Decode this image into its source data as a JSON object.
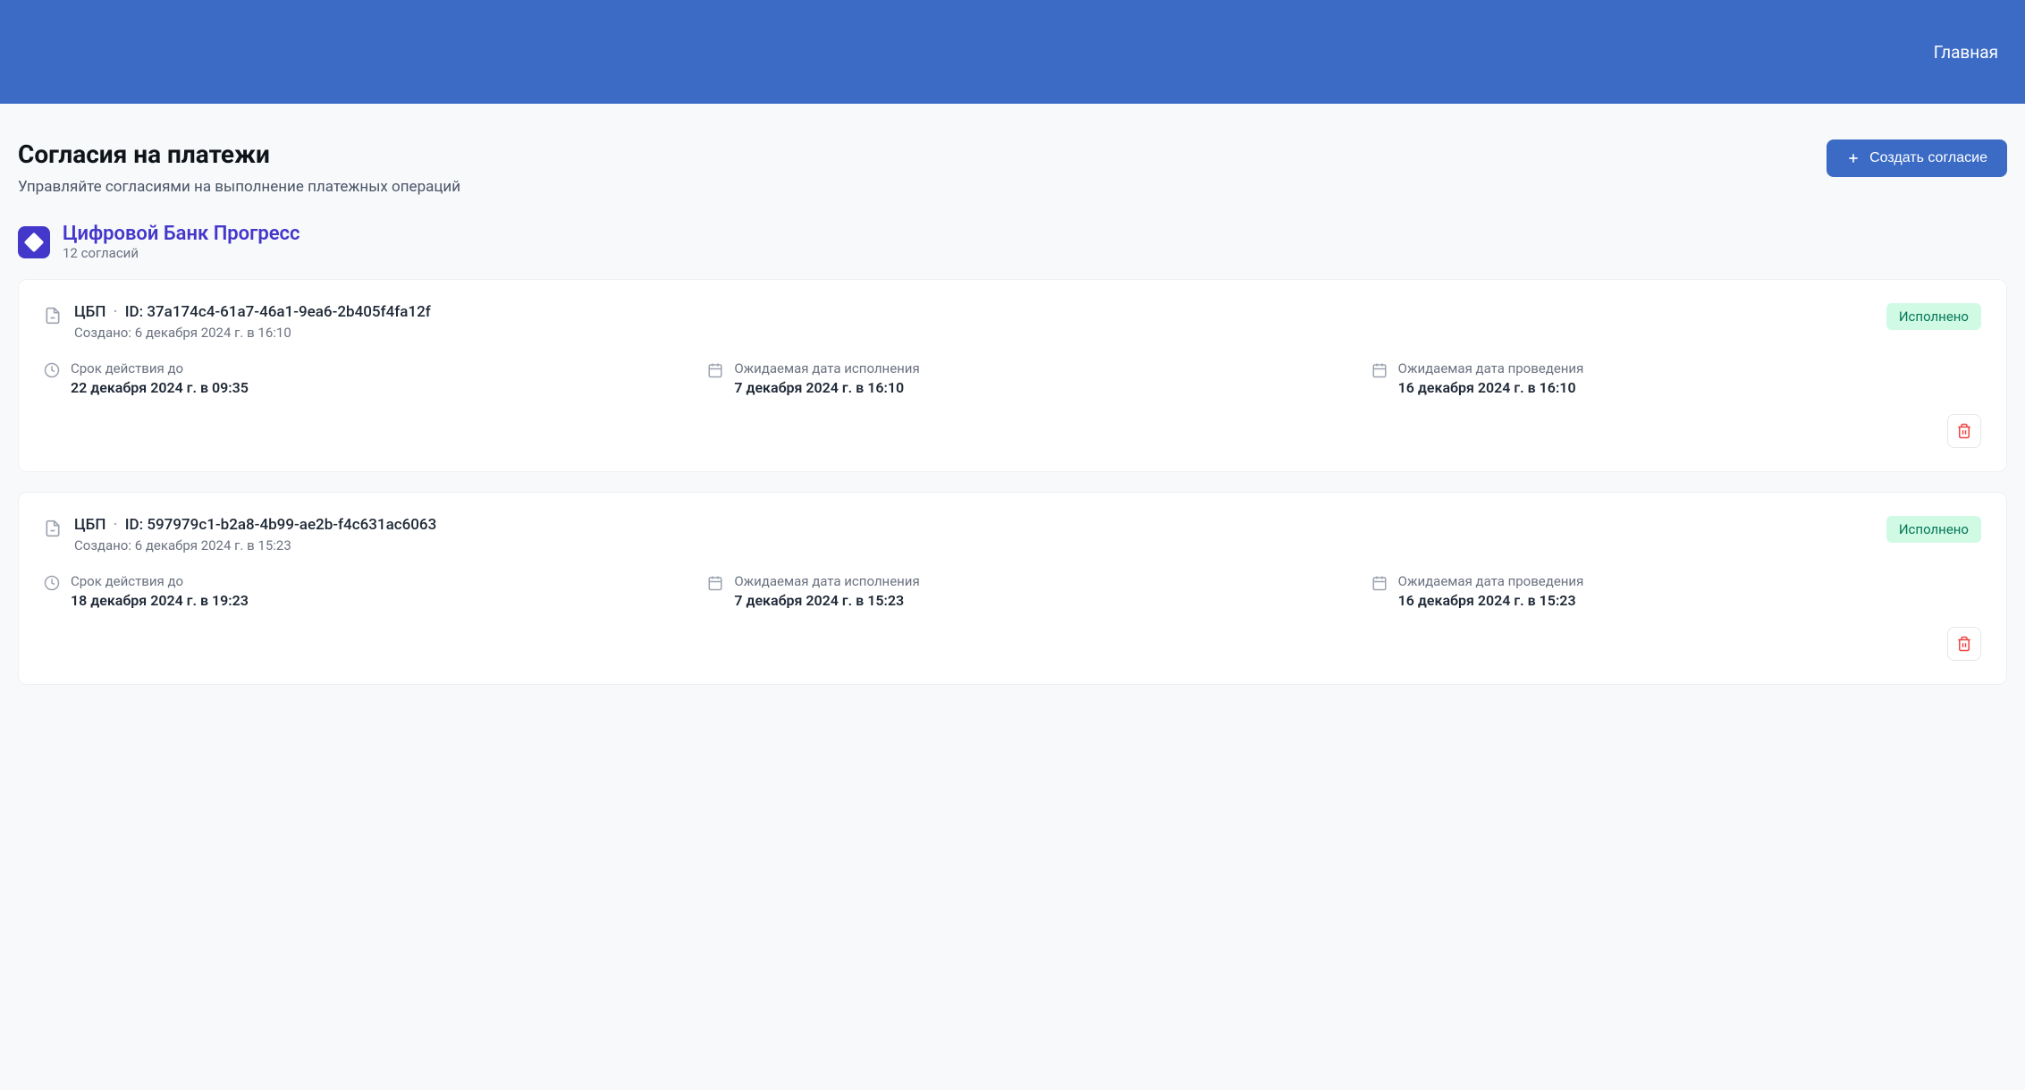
{
  "header": {
    "home_link": "Главная"
  },
  "page": {
    "title": "Согласия на платежи",
    "subtitle": "Управляйте согласиями на выполнение платежных операций",
    "create_button": "Создать согласие"
  },
  "bank": {
    "name": "Цифровой Банк Прогресс",
    "count": "12 согласий"
  },
  "labels": {
    "created_prefix": "Создано: ",
    "validity": "Срок действия до",
    "expected_execution": "Ожидаемая дата исполнения",
    "expected_settlement": "Ожидаемая дата проведения"
  },
  "consents": [
    {
      "code": "ЦБП",
      "id_label": "ID: 37a174c4-61a7-46a1-9ea6-2b405f4fa12f",
      "created": "6 декабря 2024 г. в 16:10",
      "status": "Исполнено",
      "validity_date": "22 декабря 2024 г. в 09:35",
      "execution_date": "7 декабря 2024 г. в 16:10",
      "settlement_date": "16 декабря 2024 г. в 16:10"
    },
    {
      "code": "ЦБП",
      "id_label": "ID: 597979c1-b2a8-4b99-ae2b-f4c631ac6063",
      "created": "6 декабря 2024 г. в 15:23",
      "status": "Исполнено",
      "validity_date": "18 декабря 2024 г. в 19:23",
      "execution_date": "7 декабря 2024 г. в 15:23",
      "settlement_date": "16 декабря 2024 г. в 15:23"
    }
  ]
}
